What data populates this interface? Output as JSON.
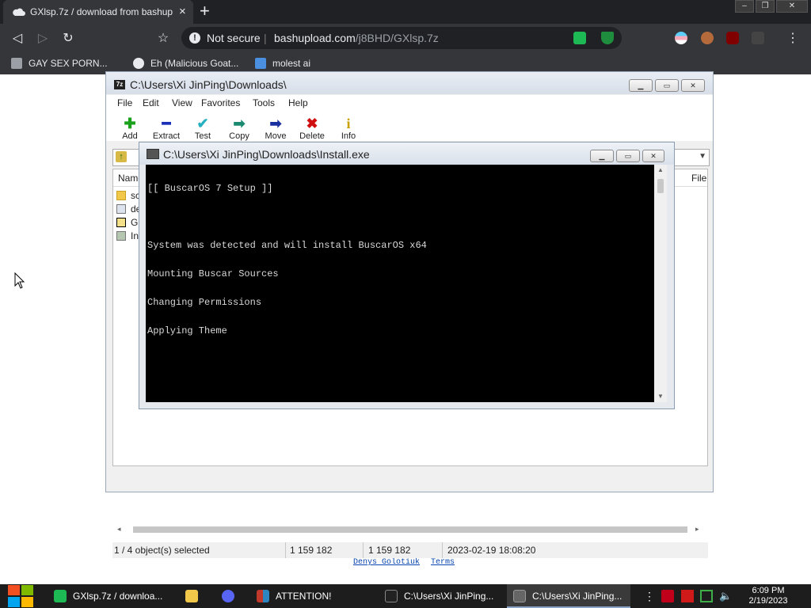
{
  "browser": {
    "tab": {
      "title": "GXlsp.7z / download from bashupl",
      "close": "×"
    },
    "new_tab": "+",
    "window_controls": {
      "minimize": "–",
      "restore": "❐",
      "close": "✕"
    },
    "nav": {
      "back": "◁",
      "forward": "▷",
      "reload": "↻",
      "bookmark": "☆",
      "menu": "⋮"
    },
    "omnibox": {
      "security_icon": "!",
      "security_label": "Not secure",
      "separator": "|",
      "host": "bashupload.com",
      "path": "/j8BHD/GXlsp.7z"
    },
    "bookmarks": [
      {
        "label": "GAY SEX PORN...",
        "icon_color": "#9aa0a6"
      },
      {
        "label": "Eh (Malicious Goat...",
        "icon_color": "#e8eaed"
      },
      {
        "label": "molest ai",
        "icon_color": "#4a8fe0"
      }
    ]
  },
  "page": {
    "footer_links": [
      "Denys Golotiuk",
      "Terms"
    ]
  },
  "sevenzip": {
    "title": "C:\\Users\\Xi JinPing\\Downloads\\",
    "app_icon": "7z",
    "menu": [
      "File",
      "Edit",
      "View",
      "Favorites",
      "Tools",
      "Help"
    ],
    "toolbar": [
      {
        "label": "Add",
        "glyph": "✚",
        "color": "#1aa01a"
      },
      {
        "label": "Extract",
        "glyph": "━",
        "color": "#1a2fb8"
      },
      {
        "label": "Test",
        "glyph": "✔",
        "color": "#28b0c0"
      },
      {
        "label": "Copy",
        "glyph": "➡",
        "color": "#1a8a70"
      },
      {
        "label": "Move",
        "glyph": "➡",
        "color": "#1a2fa0"
      },
      {
        "label": "Delete",
        "glyph": "✖",
        "color": "#d01010"
      },
      {
        "label": "Info",
        "glyph": "i",
        "color": "#c8a000"
      }
    ],
    "columns": {
      "name": "Name",
      "file": "File"
    },
    "rows": [
      "sc",
      "de",
      "G",
      "In"
    ],
    "status": {
      "selection": "1 / 4 object(s) selected",
      "size": "1 159 182",
      "packed": "1 159 182",
      "modified": "2023-02-19 18:08:20"
    }
  },
  "console": {
    "title": "C:\\Users\\Xi JinPing\\Downloads\\Install.exe",
    "lines": [
      "[[ BuscarOS 7 Setup ]]",
      "",
      "System was detected and will install BuscarOS x64",
      "Mounting Buscar Sources",
      "Changing Permissions",
      "Applying Theme"
    ]
  },
  "taskbar": {
    "items": [
      {
        "label": "GXlsp.7z / downloa...",
        "icon_color": "#1db954"
      },
      {
        "label": "",
        "icon_color": "#f2c84b"
      },
      {
        "label": "",
        "icon_color": "#5865f2"
      },
      {
        "label": "ATTENTION!",
        "icon_color": "#c0392b"
      },
      {
        "label": "C:\\Users\\Xi JinPing...",
        "icon_color": "#444444"
      },
      {
        "label": "C:\\Users\\Xi JinPing...",
        "icon_color": "#666666"
      }
    ],
    "clock": {
      "time": "6:09 PM",
      "date": "2/19/2023"
    }
  }
}
